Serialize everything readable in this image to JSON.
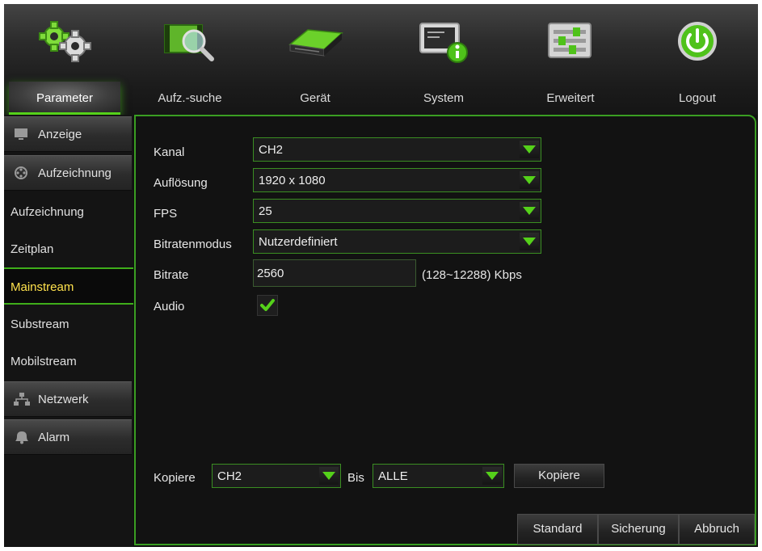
{
  "nav": {
    "items": [
      {
        "label": "Parameter",
        "icon": "gears-icon"
      },
      {
        "label": "Aufz.-suche",
        "icon": "film-search-icon"
      },
      {
        "label": "Gerät",
        "icon": "hard-drive-icon"
      },
      {
        "label": "System",
        "icon": "monitor-info-icon"
      },
      {
        "label": "Erweitert",
        "icon": "sliders-icon"
      },
      {
        "label": "Logout",
        "icon": "power-icon"
      }
    ],
    "active": "Parameter"
  },
  "sidebar": {
    "categories": [
      {
        "label": "Anzeige",
        "icon": "monitor-icon"
      },
      {
        "label": "Aufzeichnung",
        "icon": "film-reel-icon"
      },
      {
        "label": "Netzwerk",
        "icon": "network-icon"
      },
      {
        "label": "Alarm",
        "icon": "alarm-bell-icon"
      }
    ],
    "subitems": [
      "Aufzeichnung",
      "Zeitplan",
      "Mainstream",
      "Substream",
      "Mobilstream"
    ],
    "active_subitem": "Mainstream"
  },
  "form": {
    "kanal_label": "Kanal",
    "kanal_value": "CH2",
    "aufloesung_label": "Auflösung",
    "aufloesung_value": "1920 x 1080",
    "fps_label": "FPS",
    "fps_value": "25",
    "bitratenmodus_label": "Bitratenmodus",
    "bitratenmodus_value": "Nutzerdefiniert",
    "bitrate_label": "Bitrate",
    "bitrate_value": "2560",
    "bitrate_range": "(128~12288) Kbps",
    "audio_label": "Audio",
    "audio_checked": true
  },
  "copy": {
    "label": "Kopiere",
    "from_value": "CH2",
    "to_label": "Bis",
    "to_value": "ALLE",
    "button_label": "Kopiere"
  },
  "footer": {
    "standard_label": "Standard",
    "sicherung_label": "Sicherung",
    "abbruch_label": "Abbruch"
  },
  "colors": {
    "accent_green": "#55d11a",
    "border_green": "#3a9e22",
    "active_text": "#ffe24d",
    "background": "#0f0f0f"
  }
}
